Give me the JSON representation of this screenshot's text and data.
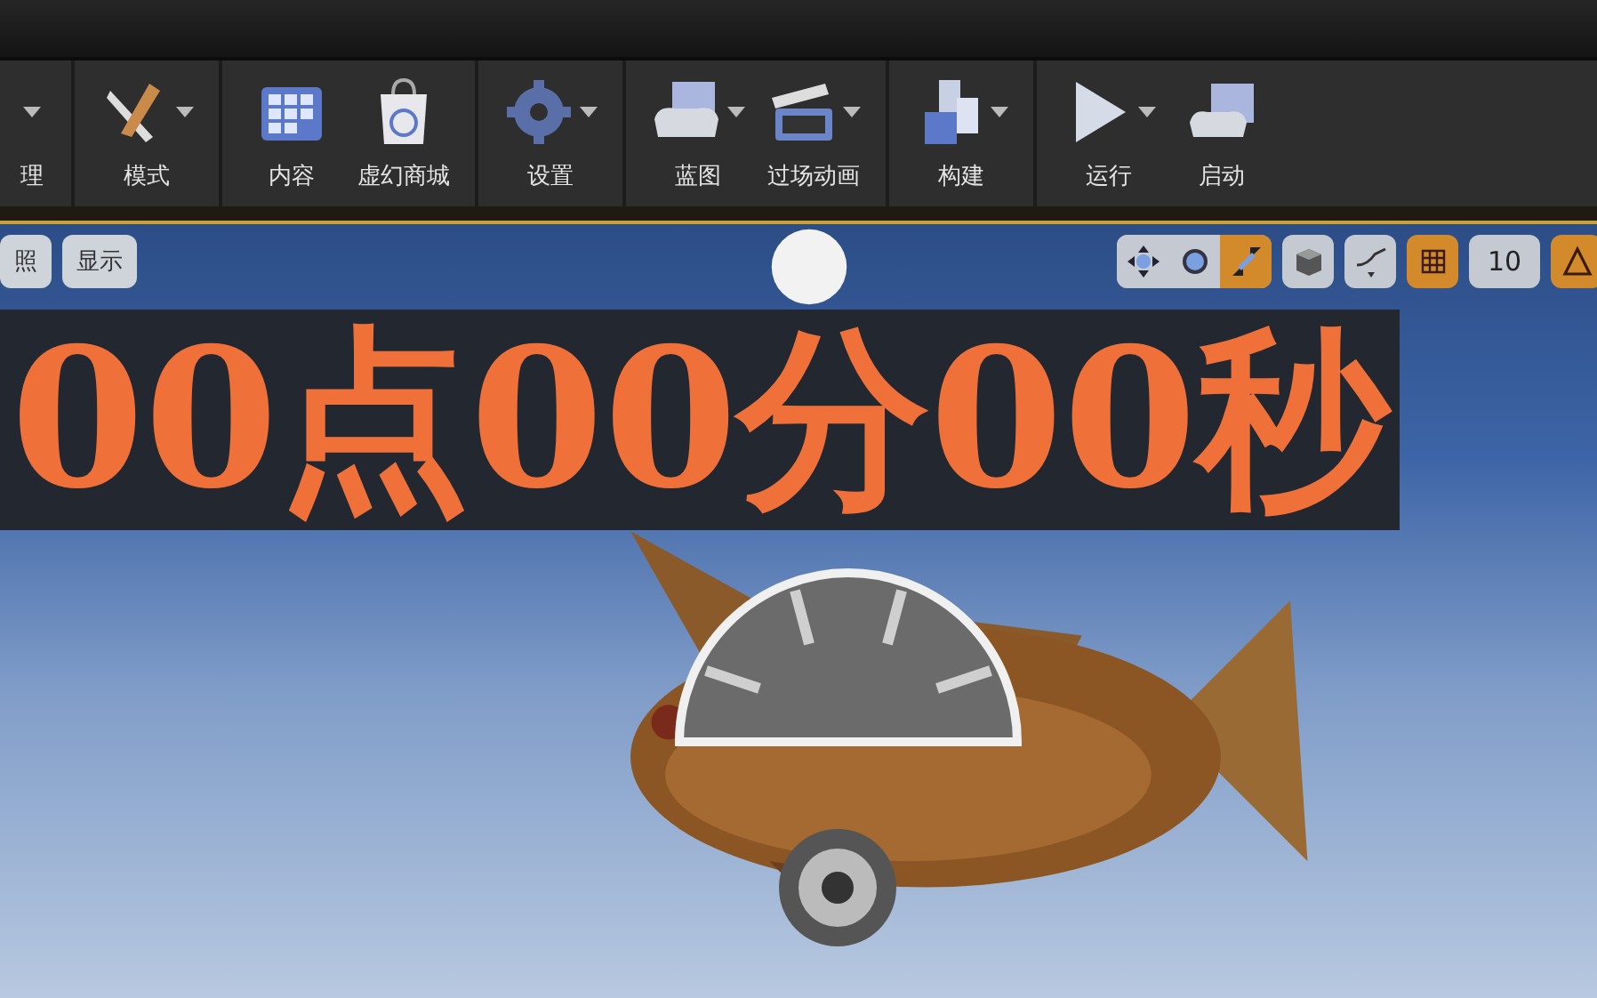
{
  "toolbar": {
    "groups": [
      {
        "items": [
          {
            "label": "理",
            "dropdown": true
          }
        ]
      },
      {
        "items": [
          {
            "label": "模式",
            "dropdown": true
          }
        ]
      },
      {
        "items": [
          {
            "label": "内容",
            "dropdown": false
          },
          {
            "label": "虚幻商城",
            "dropdown": false
          }
        ]
      },
      {
        "items": [
          {
            "label": "设置",
            "dropdown": true
          }
        ]
      },
      {
        "items": [
          {
            "label": "蓝图",
            "dropdown": true
          },
          {
            "label": "过场动画",
            "dropdown": true
          }
        ]
      },
      {
        "items": [
          {
            "label": "构建",
            "dropdown": true
          }
        ]
      },
      {
        "items": [
          {
            "label": "运行",
            "dropdown": true
          },
          {
            "label": "启动",
            "dropdown": false
          }
        ]
      }
    ]
  },
  "viewport": {
    "left_buttons": [
      "照",
      "显示"
    ],
    "transform_tools": [
      {
        "selected": false
      },
      {
        "selected": false
      },
      {
        "selected": true
      }
    ],
    "grid_snap": {
      "on": true
    },
    "grid_size": "10",
    "angle_snap": {
      "on": true
    },
    "scene_text": "00点00分00秒"
  }
}
